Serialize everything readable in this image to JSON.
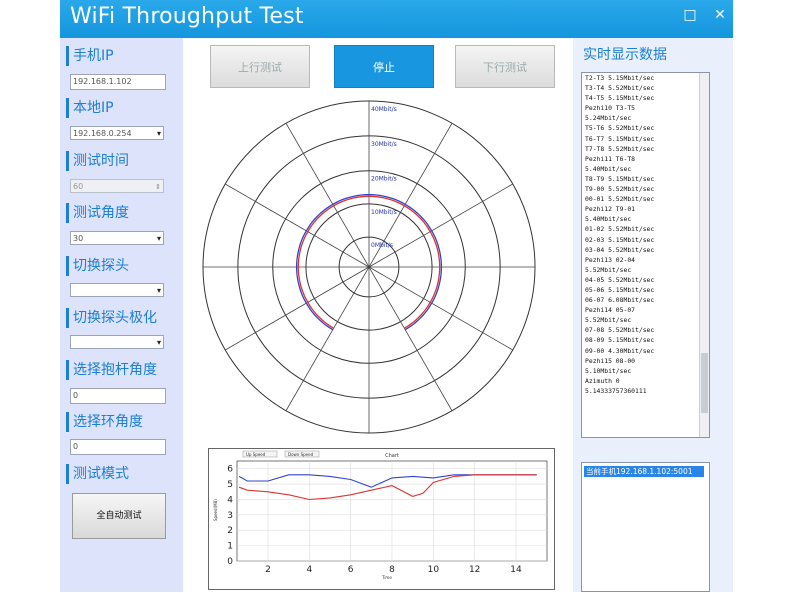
{
  "window": {
    "title": "WiFi Throughput Test",
    "close_glyph": "✕",
    "max_glyph": "□"
  },
  "left": {
    "phone_ip_label": "手机IP",
    "phone_ip_value": "192.168.1.102",
    "local_ip_label": "本地IP",
    "local_ip_value": "192.168.0.254",
    "test_time_label": "测试时间",
    "test_time_value": "60",
    "test_angle_label": "测试角度",
    "test_angle_value": "30",
    "switch_probe_label": "切换探头",
    "switch_probe_value": "",
    "switch_probe_pol_label": "切换探头极化",
    "switch_probe_pol_value": "",
    "select_pole_angle_label": "选择抱杆角度",
    "select_pole_angle_value": "0",
    "select_ring_angle_label": "选择环角度",
    "select_ring_angle_value": "0",
    "test_mode_label": "测试模式",
    "full_test_button": "全自动测试"
  },
  "toolbar": {
    "up_label": "上行测试",
    "stop_label": "停止",
    "down_label": "下行测试"
  },
  "polar": {
    "ring_labels": [
      "40Mbit/s",
      "30Mbit/s",
      "20Mbit/s",
      "10Mbit/s",
      "0Mbit/s"
    ]
  },
  "right": {
    "title": "实时显示数据",
    "log_lines": [
      "T2-T3 5.15Mbit/sec",
      "T3-T4 5.52Mbit/sec",
      "T4-T5 5.15Mbit/sec",
      "Pezhi10 T3-T5",
      "5.24Mbit/sec",
      "T5-T6 5.52Mbit/sec",
      "T6-T7 5.15Mbit/sec",
      "T7-T8 5.52Mbit/sec",
      "Pezhi11 T6-T8",
      "5.40Mbit/sec",
      "T8-T9 5.15Mbit/sec",
      "T9-00 5.52Mbit/sec",
      "00-01 5.52Mbit/sec",
      "Pezhi12 T9-01",
      "5.40Mbit/sec",
      "01-02 5.52Mbit/sec",
      "02-03 5.15Mbit/sec",
      "03-04 5.52Mbit/sec",
      "Pezhi13 02-04",
      "5.52Mbit/sec",
      "04-05 5.52Mbit/sec",
      "05-06 5.15Mbit/sec",
      "06-07 6.08Mbit/sec",
      "Pezhi14 05-07",
      "5.52Mbit/sec",
      "07-08 5.52Mbit/sec",
      "08-09 5.15Mbit/sec",
      "09-00 4.30Mbit/sec",
      "Pezhi15 08-00",
      "5.10Mbit/sec",
      "Azimuth 0",
      "5.14333757360111"
    ],
    "connection": "当前手机192.168.1.102:5001"
  },
  "chart_data": {
    "type": "line",
    "title": "Chart",
    "legend": [
      "Up Speed",
      "Down Speed"
    ],
    "legend_position": "top-left",
    "xlabel": "Time",
    "ylabel": "Speed(MB)",
    "xlim": [
      0.5,
      15.5
    ],
    "ylim": [
      0,
      6.5
    ],
    "xticks": [
      2,
      4,
      6,
      8,
      10,
      12,
      14
    ],
    "yticks": [
      0,
      1,
      2,
      3,
      4,
      5,
      6
    ],
    "grid": true,
    "series": [
      {
        "name": "Up Speed",
        "color": "#3344cc",
        "x": [
          0.6,
          1,
          2,
          3,
          4,
          5,
          6,
          7,
          8,
          9,
          10,
          11,
          12,
          13,
          14,
          15
        ],
        "y": [
          5.5,
          5.2,
          5.2,
          5.6,
          5.6,
          5.5,
          5.3,
          4.8,
          5.4,
          5.5,
          5.4,
          5.6,
          5.6,
          5.6,
          5.6,
          5.6
        ]
      },
      {
        "name": "Down Speed",
        "color": "#dd3333",
        "x": [
          0.6,
          1,
          2,
          3,
          4,
          5,
          6,
          7,
          8,
          9,
          9.5,
          10,
          11,
          12,
          13,
          14,
          15
        ],
        "y": [
          4.8,
          4.6,
          4.5,
          4.3,
          4.0,
          4.1,
          4.3,
          4.6,
          4.9,
          4.2,
          4.4,
          5.1,
          5.5,
          5.6,
          5.6,
          5.6,
          5.6
        ]
      }
    ],
    "polar": {
      "type": "polar",
      "ring_values": [
        0,
        10,
        20,
        30,
        40
      ],
      "series": [
        {
          "name": "Up Speed",
          "color": "#3344cc",
          "start_deg": 210,
          "end_deg": 510,
          "radius": 12.5
        },
        {
          "name": "Down Speed",
          "color": "#dd3333",
          "start_deg": 210,
          "end_deg": 510,
          "radius": 12.0
        }
      ]
    }
  }
}
